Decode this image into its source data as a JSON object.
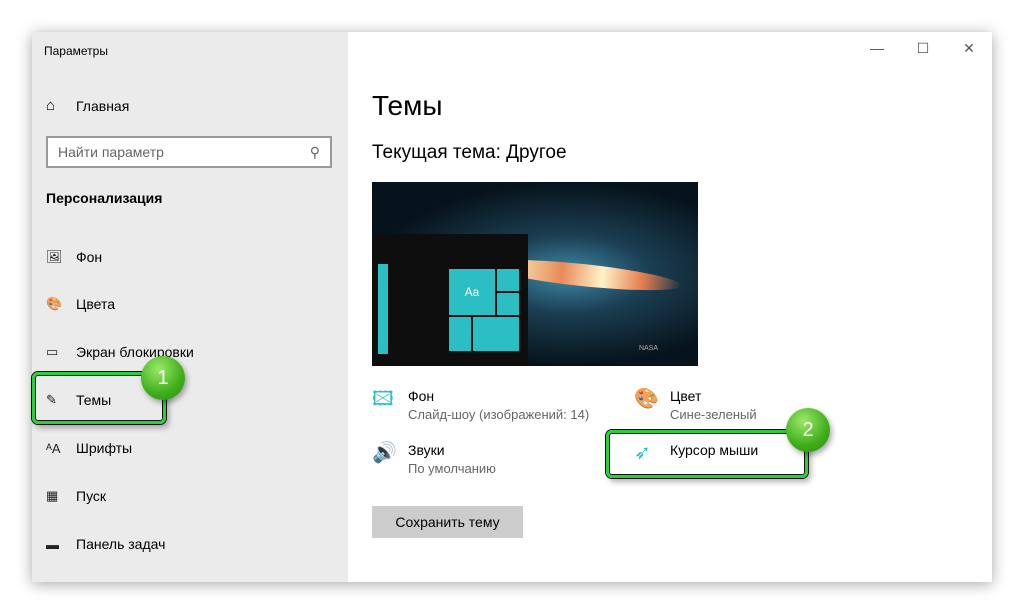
{
  "window": {
    "title": "Параметры",
    "controls": [
      "—",
      "☐",
      "✕"
    ]
  },
  "sidebar": {
    "home": "Главная",
    "search_placeholder": "Найти параметр",
    "section": "Персонализация",
    "items": [
      {
        "label": "Фон",
        "icon": "🖼"
      },
      {
        "label": "Цвета",
        "icon": "🎨"
      },
      {
        "label": "Экран блокировки",
        "icon": "▭"
      },
      {
        "label": "Темы",
        "icon": "✎"
      },
      {
        "label": "Шрифты",
        "icon": "ᴬA"
      },
      {
        "label": "Пуск",
        "icon": "▦"
      },
      {
        "label": "Панель задач",
        "icon": "▬"
      }
    ]
  },
  "main": {
    "title": "Темы",
    "current_theme": "Текущая тема: Другое",
    "preview_tile_text": "Aa",
    "preview_watermark": "NASA",
    "props": [
      {
        "label": "Фон",
        "value": "Слайд-шоу (изображений: 14)"
      },
      {
        "label": "Цвет",
        "value": "Сине-зеленый"
      },
      {
        "label": "Звуки",
        "value": "По умолчанию"
      },
      {
        "label": "Курсор мыши"
      }
    ],
    "save_button": "Сохранить тему"
  },
  "annotations": [
    "1",
    "2"
  ],
  "accent": "#2bbfc4"
}
